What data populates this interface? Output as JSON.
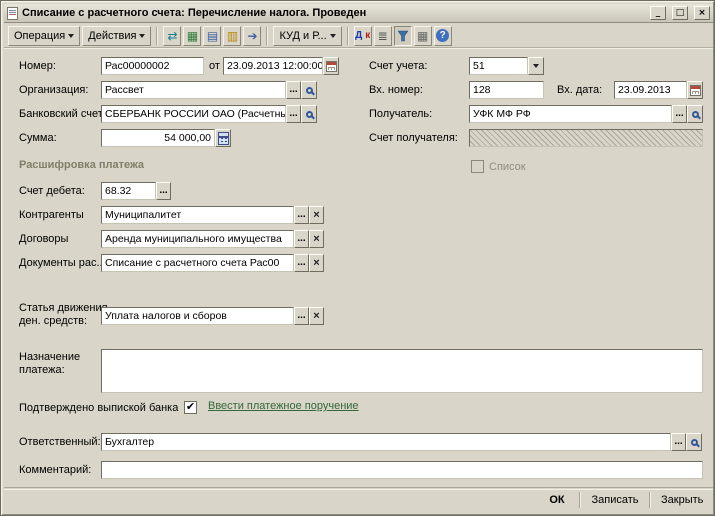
{
  "window": {
    "title": "Списание с расчетного счета: Перечисление налога. Проведен"
  },
  "icons": {
    "minimize": "_",
    "maximize": "□",
    "close": "×",
    "reread": "⇄",
    "journal": "▦",
    "copy": "▤",
    "print": "▥",
    "goto": "➔",
    "dtkt_d": "Д",
    "dtkt_k": "к",
    "structure": "≣",
    "table": "▦",
    "help": "?",
    "ellipsis": "...",
    "clear": "×",
    "check": "✔"
  },
  "toolbar": {
    "operation": "Операция",
    "actions": "Действия",
    "kud": "КУД и Р..."
  },
  "form": {
    "number_label": "Номер:",
    "number_value": "Рас00000002",
    "from_label": "от",
    "date_value": "23.09.2013 12:00:00",
    "account_label": "Счет учета:",
    "account_value": "51",
    "organization_label": "Организация:",
    "organization_value": "Рассвет",
    "incoming_number_label": "Вх. номер:",
    "incoming_number_value": "128",
    "incoming_date_label": "Вх. дата:",
    "incoming_date_value": "23.09.2013",
    "bank_account_label": "Банковский счет:",
    "bank_account_value": "СБЕРБАНК РОССИИ ОАО (Расчетны",
    "receiver_label": "Получатель:",
    "receiver_value": "УФК МФ РФ",
    "amount_label": "Сумма:",
    "amount_value": "54 000,00",
    "receiver_account_label": "Счет получателя:",
    "receiver_account_value": ""
  },
  "payment": {
    "section_title": "Расшифровка платежа",
    "list_label": "Список",
    "debit_label": "Счет дебета:",
    "debit_value": "68.32",
    "contractor_label": "Контрагенты",
    "contractor_value": "Муниципалитет",
    "contract_label": "Договоры",
    "contract_value": "Аренда муниципального имущества",
    "document_label": "Документы рас...",
    "document_value": "Списание с расчетного счета Рас00",
    "cashflow_label1": "Статья движения",
    "cashflow_label2": "ден. средств:",
    "cashflow_value": "Уплата налогов и сборов",
    "purpose_label1": "Назначение",
    "purpose_label2": "платежа:",
    "purpose_value": "",
    "confirmed_label": "Подтверждено выпиской банка",
    "link_label": "Ввести платежное поручение",
    "responsible_label": "Ответственный:",
    "responsible_value": "Бухгалтер",
    "comment_label": "Комментарий:",
    "comment_value": ""
  },
  "footer": {
    "ok": "ОК",
    "save": "Записать",
    "close": "Закрыть"
  },
  "colors": {
    "window_bg": "#d9d5c9",
    "field_bg": "#ffffff",
    "section_title": "#7f7e66",
    "link": "#35683a"
  }
}
